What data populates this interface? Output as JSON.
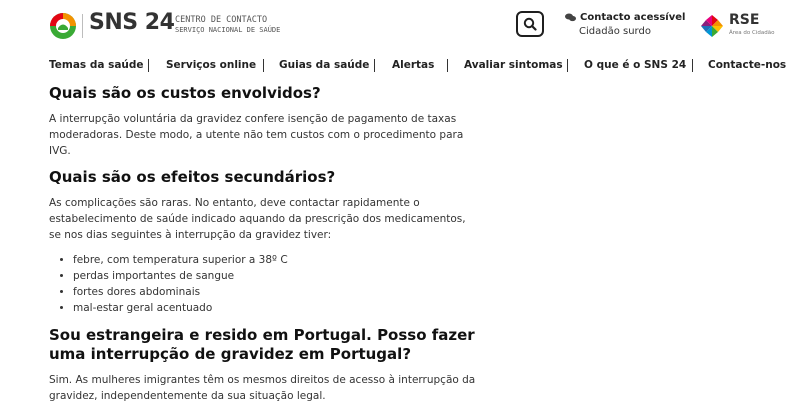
{
  "header": {
    "brand": "SNS 24",
    "brand_sub_line1": "CENTRO DE CONTACTO",
    "brand_sub_line2": "SERVIÇO NACIONAL DE SAÚDE",
    "accessible_contact_title": "Contacto acessível",
    "accessible_contact_sub": "Cidadão surdo",
    "rse_label": "RSE",
    "rse_sub": "Área do Cidadão"
  },
  "nav": {
    "items": [
      "Temas da saúde",
      "Serviços online",
      "Guias da saúde",
      "Alertas",
      "Avaliar sintomas",
      "O que é o SNS 24",
      "Contacte-nos"
    ]
  },
  "content": {
    "sections": [
      {
        "heading": "Quais são os custos envolvidos?",
        "paragraph": "A interrupção voluntária da gravidez confere isenção de pagamento de taxas moderadoras. Deste modo, a utente não tem custos com o procedimento para IVG."
      },
      {
        "heading": "Quais são os efeitos secundários?",
        "paragraph": "As complicações são raras. No entanto, deve contactar rapidamente o estabelecimento de saúde indicado aquando da prescrição dos medicamentos, se nos dias seguintes à interrupção da gravidez tiver:",
        "list": [
          "febre, com temperatura superior a 38º C",
          "perdas importantes de sangue",
          "fortes dores abdominais",
          "mal-estar geral acentuado"
        ]
      },
      {
        "heading": "Sou estrangeira e resido em Portugal. Posso fazer uma interrupção de gravidez em Portugal?",
        "paragraph": "Sim. As mulheres imigrantes têm os mesmos direitos de acesso à interrupção da gravidez, independentemente da sua situação legal."
      }
    ]
  },
  "colors": {
    "logo_green": "#3aaa35",
    "logo_orange": "#f39200",
    "logo_red": "#e30613",
    "text_dark": "#1f1f1f"
  },
  "icons": [
    "sns24-logo-icon",
    "search-icon",
    "chat-bubbles-icon",
    "rse-logo-icon"
  ]
}
